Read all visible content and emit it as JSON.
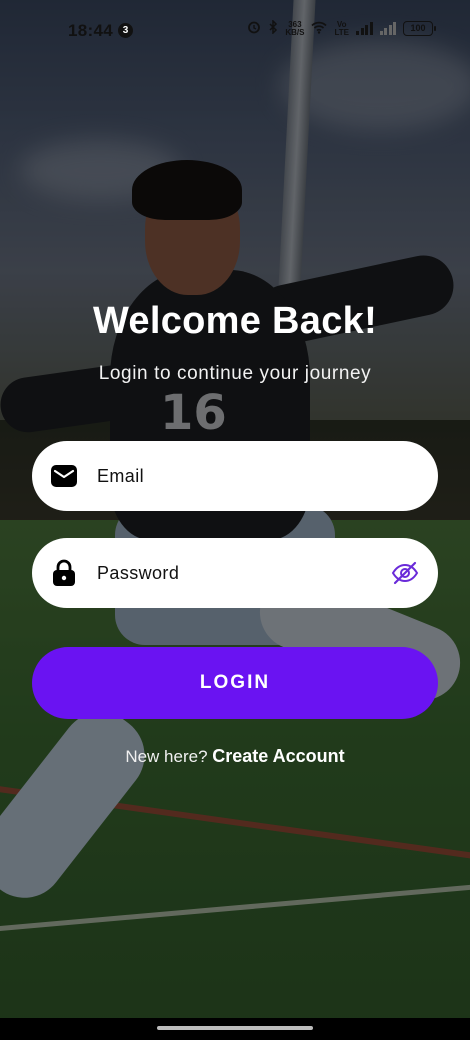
{
  "status_bar": {
    "time": "18:44",
    "notification_count": "3",
    "net_speed_top": "363",
    "net_speed_bottom": "KB/S",
    "volte_top": "Vo",
    "volte_bottom": "LTE",
    "battery": "100"
  },
  "login": {
    "title": "Welcome Back!",
    "subtitle": "Login to continue your journey",
    "email_placeholder": "Email",
    "password_placeholder": "Password",
    "login_button": "LOGIN",
    "signup_prompt": "New here?",
    "signup_link": "Create Account"
  },
  "colors": {
    "accent": "#6a13f2",
    "eye_icon": "#6a2bd9"
  }
}
